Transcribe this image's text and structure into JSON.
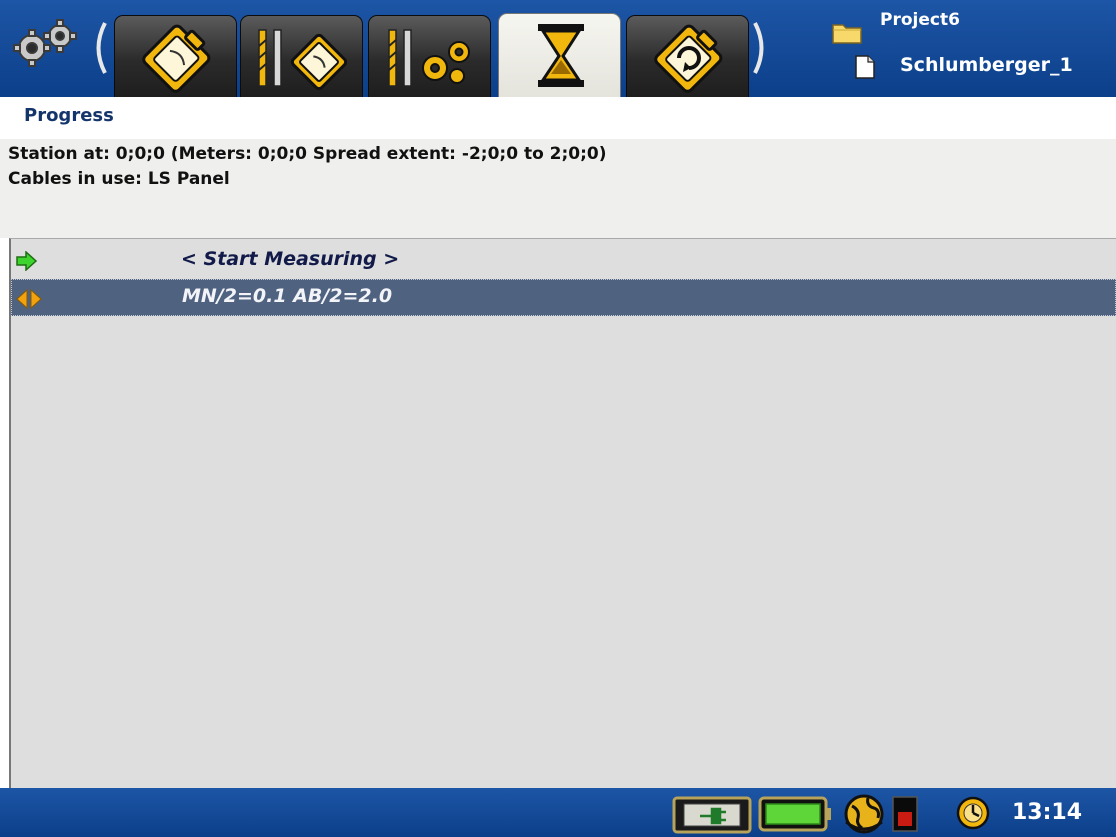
{
  "header": {
    "project_name": "Project6",
    "file_name": "Schlumberger_1",
    "tabs": [
      {
        "icon": "clipboard-icon",
        "active": false
      },
      {
        "icon": "electrode-clipboard-icon",
        "active": false
      },
      {
        "icon": "electrode-settings-icon",
        "active": false
      },
      {
        "icon": "hourglass-icon",
        "active": true
      },
      {
        "icon": "clipboard-refresh-icon",
        "active": false
      }
    ]
  },
  "progress": {
    "title": "Progress"
  },
  "info": {
    "station_line": "Station at: 0;0;0 (Meters: 0;0;0 Spread extent: -2;0;0 to 2;0;0)",
    "cables_line": "Cables in use: LS Panel"
  },
  "list": {
    "items": [
      {
        "label": "< Start Measuring >",
        "icon": "green-arrow-icon",
        "selected": false
      },
      {
        "label": "MN/2=0.1 AB/2=2.0",
        "icon": "orange-double-arrow-icon",
        "selected": true
      }
    ]
  },
  "statusbar": {
    "time": "13:14",
    "icons": [
      "power-plug-icon",
      "battery-icon",
      "globe-icon",
      "record-indicator-icon",
      "clock-icon"
    ]
  },
  "colors": {
    "bar_blue": "#0c3f8a",
    "selection": "#4f6280",
    "tab_gold": "#f2b70d",
    "title_blue": "#13356c"
  }
}
